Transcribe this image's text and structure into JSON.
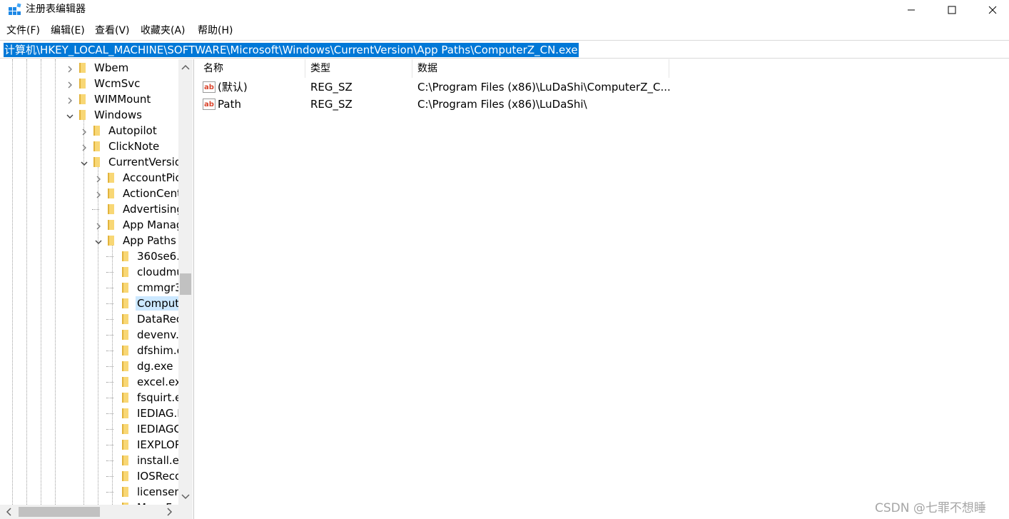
{
  "window": {
    "title": "注册表编辑器",
    "icon": "registry-editor-icon"
  },
  "menu": {
    "items": [
      "文件(F)",
      "编辑(E)",
      "查看(V)",
      "收藏夹(A)",
      "帮助(H)"
    ]
  },
  "address": {
    "path": "计算机\\HKEY_LOCAL_MACHINE\\SOFTWARE\\Microsoft\\Windows\\CurrentVersion\\App Paths\\ComputerZ_CN.exe"
  },
  "tree": {
    "items": [
      {
        "label": "Wbem",
        "expander": "chevron-right"
      },
      {
        "label": "WcmSvc",
        "expander": "chevron-right"
      },
      {
        "label": "WIMMount",
        "expander": "chevron-right"
      },
      {
        "label": "Windows",
        "expander": "chevron-down"
      },
      {
        "label": "Autopilot",
        "expander": "chevron-right"
      },
      {
        "label": "ClickNote",
        "expander": "chevron-right"
      },
      {
        "label": "CurrentVersio",
        "expander": "chevron-down"
      },
      {
        "label": "AccountPic",
        "expander": "chevron-right"
      },
      {
        "label": "ActionCent",
        "expander": "chevron-right"
      },
      {
        "label": "Advertising",
        "expander": "none"
      },
      {
        "label": "App Manag",
        "expander": "chevron-right"
      },
      {
        "label": "App Paths",
        "expander": "chevron-down"
      },
      {
        "label": "360se6.",
        "expander": "none"
      },
      {
        "label": "cloudmu",
        "expander": "none"
      },
      {
        "label": "cmmgr3",
        "expander": "none"
      },
      {
        "label": "Comput",
        "expander": "none",
        "selected": true
      },
      {
        "label": "DataRec",
        "expander": "none"
      },
      {
        "label": "devenv.",
        "expander": "none"
      },
      {
        "label": "dfshim.c",
        "expander": "none"
      },
      {
        "label": "dg.exe",
        "expander": "none"
      },
      {
        "label": "excel.ex",
        "expander": "none"
      },
      {
        "label": "fsquirt.e",
        "expander": "none"
      },
      {
        "label": "IEDIAG.E",
        "expander": "none"
      },
      {
        "label": "IEDIAGC",
        "expander": "none"
      },
      {
        "label": "IEXPLOR",
        "expander": "none"
      },
      {
        "label": "install.ex",
        "expander": "none"
      },
      {
        "label": "IOSReco",
        "expander": "none"
      },
      {
        "label": "licensen",
        "expander": "none"
      },
      {
        "label": "MoveF",
        "expander": "none"
      }
    ]
  },
  "values_list": {
    "columns": [
      "名称",
      "类型",
      "数据"
    ],
    "rows": [
      {
        "name": "(默认)",
        "type": "REG_SZ",
        "data": "C:\\Program Files (x86)\\LuDaShi\\ComputerZ_C...",
        "icon": "string-value-icon"
      },
      {
        "name": "Path",
        "type": "REG_SZ",
        "data": "C:\\Program Files (x86)\\LuDaShi\\",
        "icon": "string-value-icon"
      }
    ]
  },
  "watermark": "CSDN @七罪不想睡",
  "colors": {
    "selection_blue": "#0078d7",
    "tree_selected": "#cce8ff",
    "folder_yellow": "#f8d775"
  }
}
